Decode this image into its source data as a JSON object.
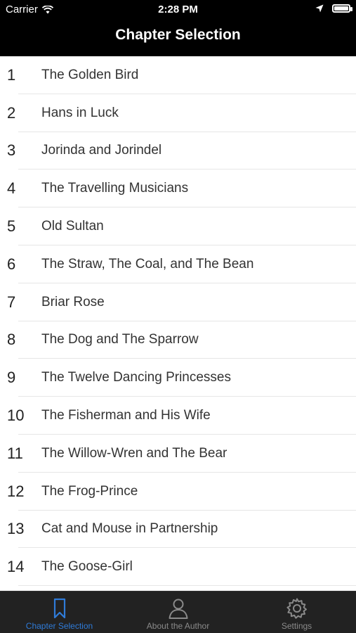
{
  "status": {
    "carrier": "Carrier",
    "time": "2:28 PM"
  },
  "nav": {
    "title": "Chapter Selection"
  },
  "chapters": [
    {
      "num": "1",
      "title": "The Golden Bird"
    },
    {
      "num": "2",
      "title": "Hans in Luck"
    },
    {
      "num": "3",
      "title": "Jorinda and Jorindel"
    },
    {
      "num": "4",
      "title": "The Travelling Musicians"
    },
    {
      "num": "5",
      "title": "Old Sultan"
    },
    {
      "num": "6",
      "title": "The Straw, The Coal, and The Bean"
    },
    {
      "num": "7",
      "title": "Briar Rose"
    },
    {
      "num": "8",
      "title": "The Dog and The Sparrow"
    },
    {
      "num": "9",
      "title": "The Twelve Dancing Princesses"
    },
    {
      "num": "10",
      "title": "The Fisherman and His Wife"
    },
    {
      "num": "11",
      "title": "The Willow-Wren and The Bear"
    },
    {
      "num": "12",
      "title": "The Frog-Prince"
    },
    {
      "num": "13",
      "title": "Cat and Mouse in Partnership"
    },
    {
      "num": "14",
      "title": "The Goose-Girl"
    }
  ],
  "tabs": [
    {
      "label": "Chapter Selection",
      "icon": "bookmark-icon",
      "active": true
    },
    {
      "label": "About the Author",
      "icon": "person-icon",
      "active": false
    },
    {
      "label": "Settings",
      "icon": "gear-icon",
      "active": false
    }
  ],
  "colors": {
    "active_tab": "#2f7bd8",
    "inactive_tab": "#8a8a8a",
    "bar_background": "#000000",
    "tabbar_background": "#222222"
  }
}
